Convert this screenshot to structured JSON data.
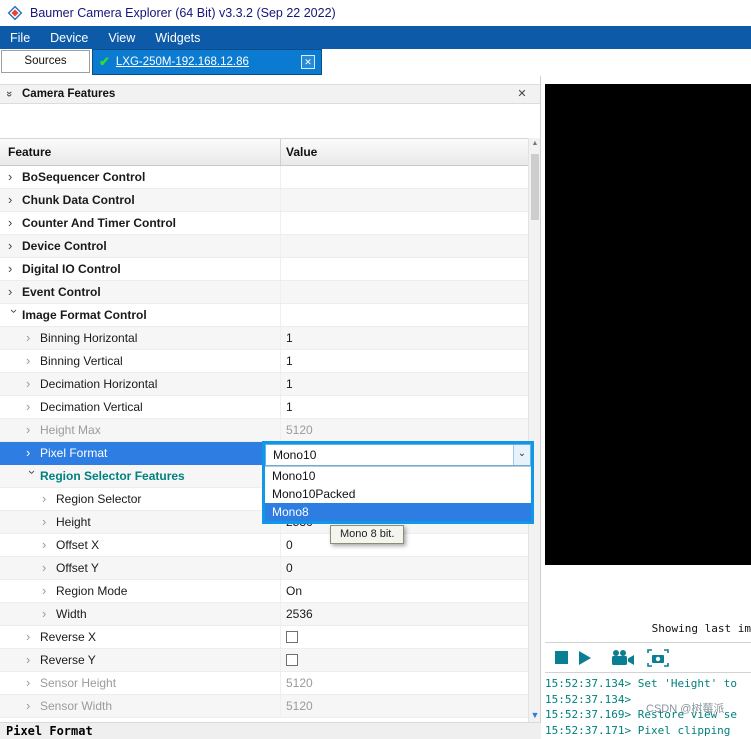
{
  "window": {
    "title": "Baumer Camera Explorer (64 Bit) v3.3.2 (Sep 22 2022)"
  },
  "menu": {
    "items": [
      "File",
      "Device",
      "View",
      "Widgets"
    ]
  },
  "tabs": {
    "sources_label": "Sources",
    "device_label": "LXG-250M-192.168.12.86"
  },
  "panel": {
    "title": "Camera Features"
  },
  "toolbar": {
    "icons": [
      "expand-all-icon",
      "collapse-all-icon",
      "refresh-icon",
      "xml-export-icon",
      "search-icon"
    ],
    "search_value": "",
    "help_label": "?"
  },
  "table": {
    "columns": [
      "Feature",
      "Value"
    ],
    "rows": [
      {
        "label": "BoSequencer Control",
        "value": "",
        "level": 0,
        "kind": "category",
        "expanded": false
      },
      {
        "label": "Chunk Data Control",
        "value": "",
        "level": 0,
        "kind": "category",
        "expanded": false
      },
      {
        "label": "Counter And Timer Control",
        "value": "",
        "level": 0,
        "kind": "category",
        "expanded": false
      },
      {
        "label": "Device Control",
        "value": "",
        "level": 0,
        "kind": "category",
        "expanded": false
      },
      {
        "label": "Digital IO Control",
        "value": "",
        "level": 0,
        "kind": "category",
        "expanded": false
      },
      {
        "label": "Event Control",
        "value": "",
        "level": 0,
        "kind": "category",
        "expanded": false
      },
      {
        "label": "Image Format Control",
        "value": "",
        "level": 0,
        "kind": "category",
        "expanded": true
      },
      {
        "label": "Binning Horizontal",
        "value": "1",
        "level": 1
      },
      {
        "label": "Binning Vertical",
        "value": "1",
        "level": 1
      },
      {
        "label": "Decimation Horizontal",
        "value": "1",
        "level": 1
      },
      {
        "label": "Decimation Vertical",
        "value": "1",
        "level": 1
      },
      {
        "label": "Height Max",
        "value": "5120",
        "level": 1,
        "disabled": true
      },
      {
        "label": "Pixel Format",
        "value": "Mono10",
        "level": 1,
        "selected": true
      },
      {
        "label": "Region Selector Features",
        "value": "",
        "level": 1,
        "kind": "category",
        "expanded": true,
        "accent": "#008080"
      },
      {
        "label": "Region Selector",
        "value": "",
        "level": 2
      },
      {
        "label": "Height",
        "value": "2536",
        "level": 2
      },
      {
        "label": "Offset X",
        "value": "0",
        "level": 2
      },
      {
        "label": "Offset Y",
        "value": "0",
        "level": 2
      },
      {
        "label": "Region Mode",
        "value": "On",
        "level": 2
      },
      {
        "label": "Width",
        "value": "2536",
        "level": 2
      },
      {
        "label": "Reverse X",
        "value": "",
        "level": 1,
        "checkbox": true
      },
      {
        "label": "Reverse Y",
        "value": "",
        "level": 1,
        "checkbox": true
      },
      {
        "label": "Sensor Height",
        "value": "5120",
        "level": 1,
        "disabled": true
      },
      {
        "label": "Sensor Width",
        "value": "5120",
        "level": 1,
        "disabled": true
      }
    ]
  },
  "dropdown": {
    "value": "Mono10",
    "options": [
      "Mono10",
      "Mono10Packed",
      "Mono8"
    ],
    "selected_option": "Mono8",
    "tooltip": "Mono 8 bit."
  },
  "statusbar": {
    "text": "Pixel Format"
  },
  "preview": {
    "showing_text": "Showing last im",
    "logs": [
      "15:52:37.134> Set 'Height' to",
      "15:52:37.134>",
      "15:52:37.169> Restore view se",
      "15:52:37.171> Pixel clipping"
    ],
    "watermark": "CSDN @树莓派"
  },
  "colors": {
    "menubar": "#0d5ba8",
    "device_tab": "#0b7ad1",
    "selection": "#2e7de2",
    "dropdown_border": "#0f98e8",
    "accent_teal": "#008080",
    "log_text": "#00807c"
  }
}
